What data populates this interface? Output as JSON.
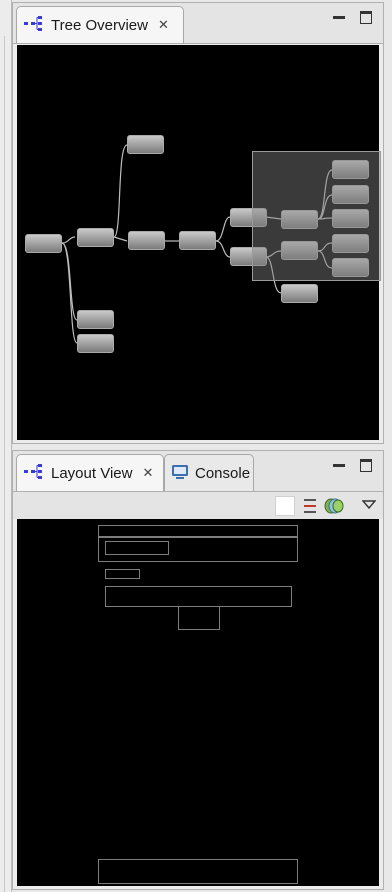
{
  "tree_overview": {
    "tab_label": "Tree Overview",
    "tab_icon": "hierarchy-icon",
    "close_icon": "close-icon",
    "controls": [
      "minimize-icon",
      "maximize-icon"
    ]
  },
  "layout_view": {
    "tabs": [
      {
        "label": "Layout View",
        "icon": "hierarchy-icon",
        "closable": true
      },
      {
        "label": "Console",
        "icon": "console-icon",
        "closable": false
      }
    ],
    "toolbar_icons": [
      "blank-icon",
      "list-icon",
      "layers-icon",
      "view-menu-icon"
    ],
    "controls": [
      "minimize-icon",
      "maximize-icon"
    ]
  },
  "colors": {
    "canvas_bg": "#000000",
    "node_fill": "#8e8e8e",
    "icon_accent": "#3b3bd6",
    "console_icon": "#3a6fb0"
  }
}
